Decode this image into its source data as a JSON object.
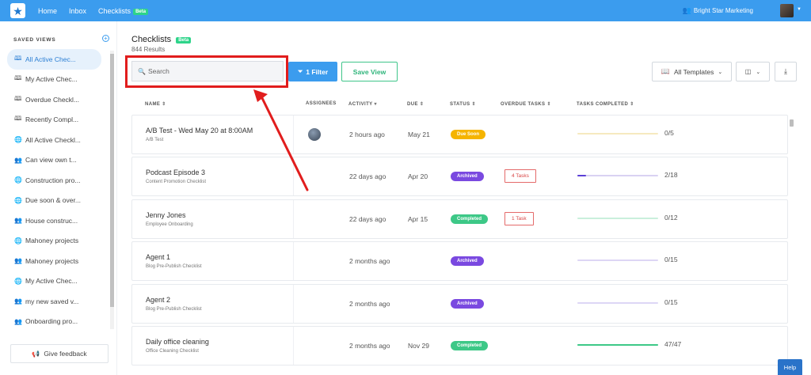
{
  "nav": {
    "home": "Home",
    "inbox": "Inbox",
    "checklists": "Checklists",
    "beta": "Beta",
    "org_name": "Bright Star Marketing"
  },
  "sidebar": {
    "title": "SAVED VIEWS",
    "items": [
      {
        "label": "All Active Chec...",
        "icon": "book-icon",
        "active": true
      },
      {
        "label": "My Active Chec...",
        "icon": "book-icon"
      },
      {
        "label": "Overdue Checkl...",
        "icon": "book-icon"
      },
      {
        "label": "Recently Compl...",
        "icon": "book-icon"
      },
      {
        "label": "All Active Checkl...",
        "icon": "globe-icon"
      },
      {
        "label": "Can view own t...",
        "icon": "users-icon"
      },
      {
        "label": "Construction pro...",
        "icon": "globe-icon"
      },
      {
        "label": "Due soon & over...",
        "icon": "globe-icon"
      },
      {
        "label": "House construc...",
        "icon": "users-icon"
      },
      {
        "label": "Mahoney projects",
        "icon": "globe-icon"
      },
      {
        "label": "Mahoney projects",
        "icon": "users-icon"
      },
      {
        "label": "My Active Chec...",
        "icon": "globe-icon"
      },
      {
        "label": "my new saved v...",
        "icon": "users-icon"
      },
      {
        "label": "Onboarding pro...",
        "icon": "users-icon"
      }
    ],
    "feedback": "Give feedback"
  },
  "main": {
    "title": "Checklists",
    "beta": "Beta",
    "results": "844 Results",
    "search_placeholder": "Search",
    "filter_label": "1 Filter",
    "save_view_label": "Save View",
    "templates_label": "All Templates"
  },
  "table": {
    "headers": {
      "name": "NAME",
      "assignees": "ASSIGNEES",
      "activity": "ACTIVITY",
      "due": "DUE",
      "status": "STATUS",
      "overdue": "OVERDUE TASKS",
      "completed": "TASKS COMPLETED"
    },
    "rows": [
      {
        "name": "A/B Test - Wed May 20 at 8:00AM",
        "template": "A/B Test",
        "has_assignee": true,
        "activity": "2 hours ago",
        "due": "May 21",
        "status": "Due Soon",
        "status_color": "#f5b400",
        "overdue": "",
        "progress": 0.0,
        "progress_color": "#f3d98a",
        "progress_track": "#f6e9bf",
        "count": "0/5"
      },
      {
        "name": "Podcast Episode 3",
        "template": "Content Promotion Checklist",
        "has_assignee": false,
        "activity": "22 days ago",
        "due": "Apr 20",
        "status": "Archived",
        "status_color": "#7a49e0",
        "overdue": "4 Tasks",
        "progress": 0.11,
        "progress_color": "#5b3fd6",
        "progress_track": "#d9d2f2",
        "count": "2/18"
      },
      {
        "name": "Jenny Jones",
        "template": "Employee Onboarding",
        "has_assignee": false,
        "activity": "22 days ago",
        "due": "Apr 15",
        "status": "Completed",
        "status_color": "#3dc887",
        "overdue": "1 Task",
        "progress": 0.0,
        "progress_color": "#9fe0c1",
        "progress_track": "#c9efdc",
        "count": "0/12"
      },
      {
        "name": "Agent 1",
        "template": "Blog Pre-Publish Checklist",
        "has_assignee": false,
        "activity": "2 months ago",
        "due": "",
        "status": "Archived",
        "status_color": "#7a49e0",
        "overdue": "",
        "progress": 0.0,
        "progress_color": "#c9bdf0",
        "progress_track": "#ddd6f5",
        "count": "0/15"
      },
      {
        "name": "Agent 2",
        "template": "Blog Pre-Publish Checklist",
        "has_assignee": false,
        "activity": "2 months ago",
        "due": "",
        "status": "Archived",
        "status_color": "#7a49e0",
        "overdue": "",
        "progress": 0.0,
        "progress_color": "#c9bdf0",
        "progress_track": "#ddd6f5",
        "count": "0/15"
      },
      {
        "name": "Daily office cleaning",
        "template": "Office Cleaning Checklist",
        "has_assignee": false,
        "activity": "2 months ago",
        "due": "Nov 29",
        "status": "Completed",
        "status_color": "#3dc887",
        "overdue": "",
        "progress": 1.0,
        "progress_color": "#3dc887",
        "progress_track": "#c9efdc",
        "count": "47/47"
      }
    ]
  },
  "help_label": "Help",
  "colors": {
    "primary": "#3b9cee",
    "annotation": "#e11d1d",
    "success": "#3dc887"
  }
}
